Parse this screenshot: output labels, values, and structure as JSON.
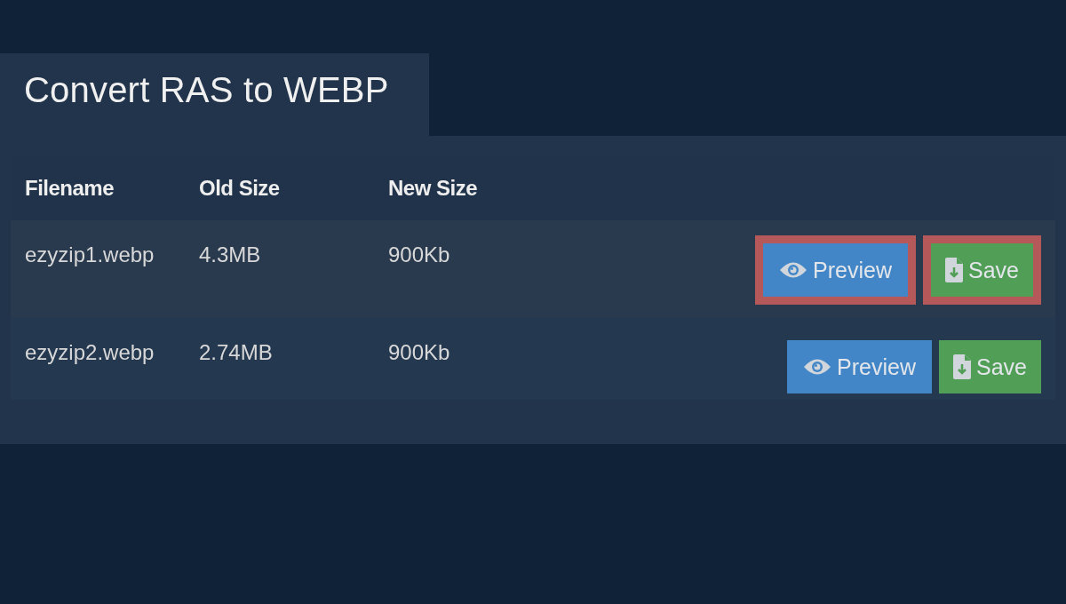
{
  "title": "Convert RAS to WEBP",
  "table": {
    "columns": [
      "Filename",
      "Old Size",
      "New Size"
    ],
    "rows": [
      {
        "filename": "ezyzip1.webp",
        "old_size": "4.3MB",
        "new_size": "900Kb",
        "highlighted": true,
        "buttons": [
          {
            "kind": "preview",
            "label": "Preview"
          },
          {
            "kind": "save",
            "label": "Save"
          }
        ]
      },
      {
        "filename": "ezyzip2.webp",
        "old_size": "2.74MB",
        "new_size": "900Kb",
        "highlighted": false,
        "buttons": [
          {
            "kind": "preview",
            "label": "Preview"
          },
          {
            "kind": "save",
            "label": "Save"
          }
        ]
      }
    ]
  }
}
